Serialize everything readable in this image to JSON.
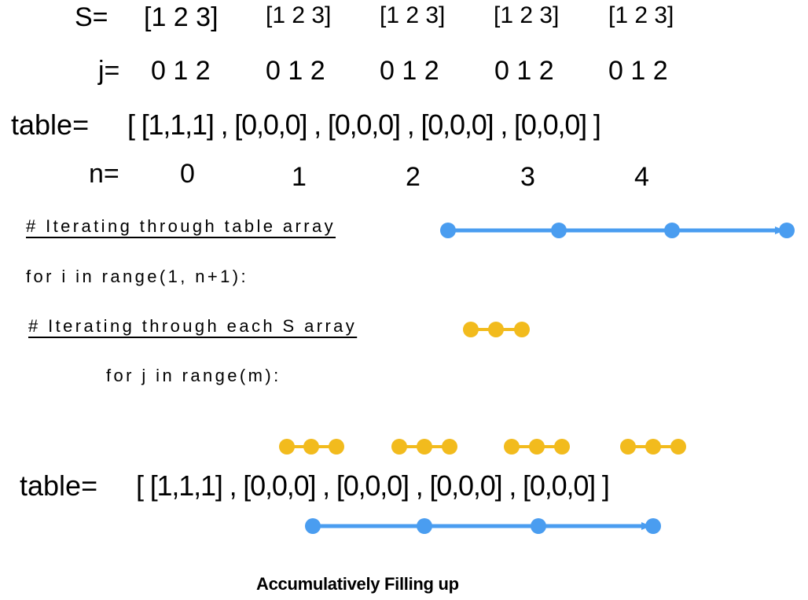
{
  "labels": {
    "s": "S=",
    "j": "j=",
    "table": "table=",
    "n": "n="
  },
  "s_groups": [
    "[1 2 3]",
    "[1 2 3]",
    "[1 2 3]",
    "[1 2 3]",
    "[1 2 3]"
  ],
  "j_groups": [
    "0 1 2",
    "0 1 2",
    "0 1 2",
    "0 1 2",
    "0 1 2"
  ],
  "table_top": "[ [1,1,1] , [0,0,0] , [0,0,0] , [0,0,0] , [0,0,0] ]",
  "n_values": [
    "0",
    "1",
    "2",
    "3",
    "4"
  ],
  "code": {
    "comment_outer": "# Iterating through table array",
    "loop_outer": "for i in range(1, n+1):",
    "comment_inner": "# Iterating through each S array",
    "loop_inner": "for j in range(m):"
  },
  "table_bottom": "[ [1,1,1] , [0,0,0] , [0,0,0] , [0,0,0] , [0,0,0] ]",
  "caption": "Accumulatively Filling up",
  "colors": {
    "blue": "#4a9df0",
    "yellow": "#f2bb1d"
  }
}
